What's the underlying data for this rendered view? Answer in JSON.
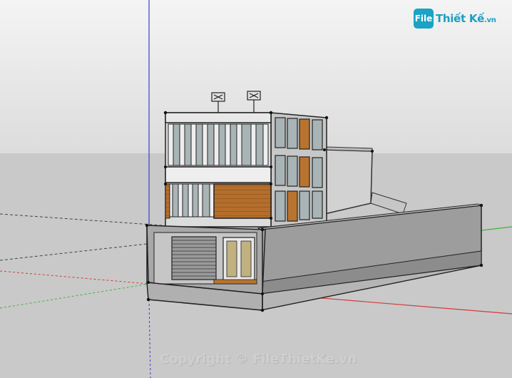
{
  "watermark": {
    "logo_mark": "File",
    "logo_text": "Thiết Kế",
    "logo_suffix": ".vn",
    "copyright": "Copyright © FileThietKe.vn"
  },
  "scene": {
    "sky_color": "#e6e6e6",
    "ground_color": "#c8c8c8",
    "axis_colors": {
      "red": "#d23c3c",
      "green": "#3cb43c",
      "blue": "#3c3cd2"
    },
    "materials": {
      "wall": "#dcdcdc",
      "wood": "#b8742e",
      "glass": "#a9b4b6",
      "fence": "#9a9a9a"
    }
  }
}
